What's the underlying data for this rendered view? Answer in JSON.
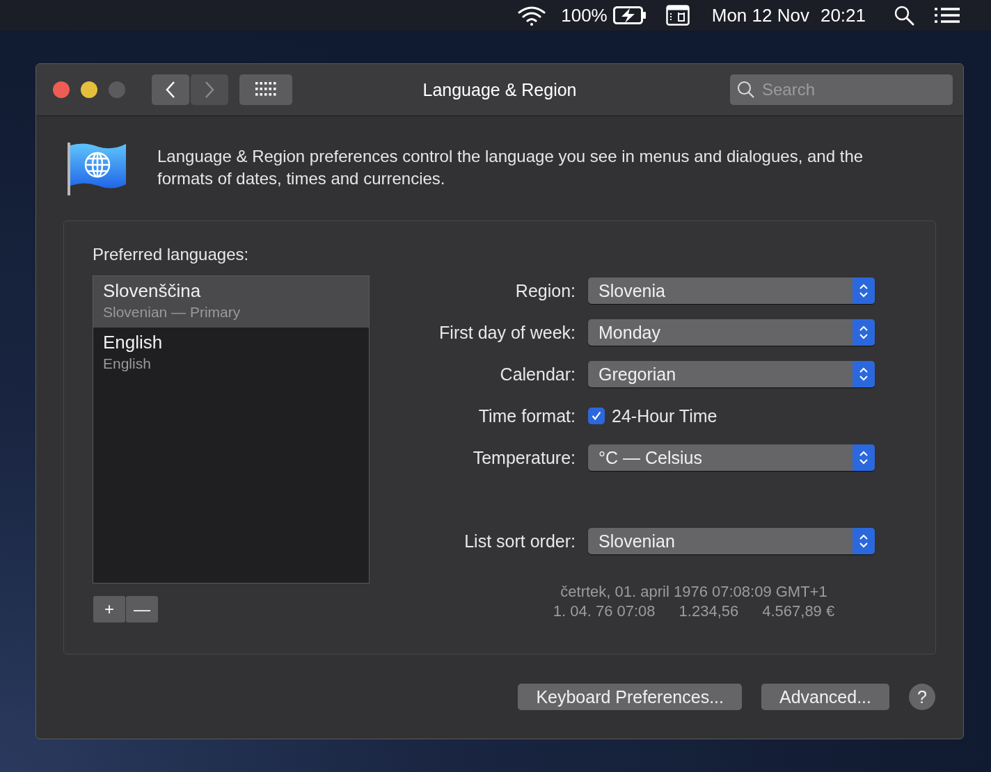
{
  "menu_bar": {
    "battery": "100%",
    "date": "Mon 12 Nov",
    "time": "20:21"
  },
  "window": {
    "title": "Language & Region",
    "search": {
      "placeholder": "Search"
    }
  },
  "intro": "Language & Region preferences control the language you see in menus and dialogues, and the formats of dates, times and currencies.",
  "languages": {
    "title": "Preferred languages:",
    "items": [
      {
        "name": "Slovenščina",
        "detail": "Slovenian — Primary",
        "selected": true
      },
      {
        "name": "English",
        "detail": "English",
        "selected": false
      }
    ],
    "add": "+",
    "remove": "—"
  },
  "settings": [
    {
      "kind": "popup",
      "label": "Region:",
      "value": "Slovenia"
    },
    {
      "kind": "popup",
      "label": "First day of week:",
      "value": "Monday"
    },
    {
      "kind": "popup",
      "label": "Calendar:",
      "value": "Gregorian"
    },
    {
      "kind": "checkbox",
      "label": "Time format:",
      "value": "24-Hour Time",
      "checked": true
    },
    {
      "kind": "popup",
      "label": "Temperature:",
      "value": "°C — Celsius"
    }
  ],
  "list_sort": {
    "label": "List sort order:",
    "value": "Slovenian"
  },
  "samples": {
    "long_date": "četrtek, 01. april 1976 07:08:09 GMT+1",
    "short_date": "1. 04. 76 07:08",
    "number": "1.234,56",
    "currency": "4.567,89 €"
  },
  "buttons": [
    {
      "label": "Keyboard Preferences..."
    },
    {
      "label": "Advanced..."
    }
  ],
  "help": "?"
}
